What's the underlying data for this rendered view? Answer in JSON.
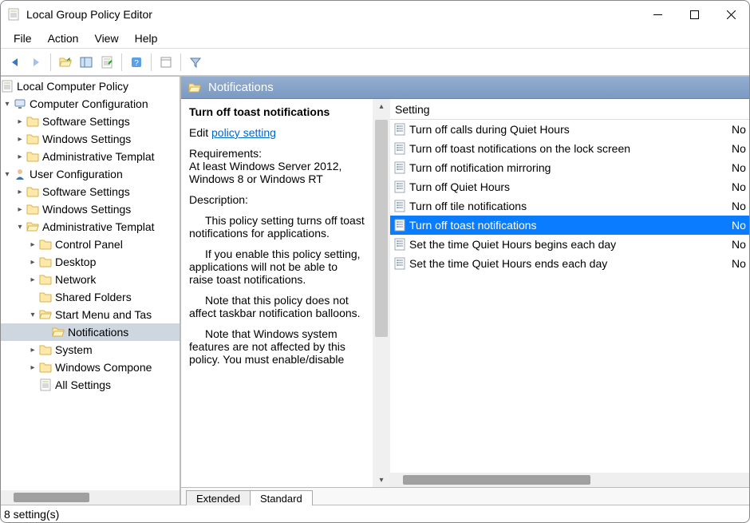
{
  "window": {
    "title": "Local Group Policy Editor"
  },
  "menu": {
    "items": [
      "File",
      "Action",
      "View",
      "Help"
    ]
  },
  "tree": {
    "root": "Local Computer Policy",
    "compConfig": "Computer Configuration",
    "cc_software": "Software Settings",
    "cc_windows": "Windows Settings",
    "cc_admin": "Administrative Templat",
    "userConfig": "User Configuration",
    "uc_software": "Software Settings",
    "uc_windows": "Windows Settings",
    "uc_admin": "Administrative Templat",
    "ctrl": "Control Panel",
    "desktop": "Desktop",
    "network": "Network",
    "shared": "Shared Folders",
    "start": "Start Menu and Tas",
    "notif": "Notifications",
    "system": "System",
    "wincomp": "Windows Compone",
    "allset": "All Settings"
  },
  "panel": {
    "heading": "Notifications",
    "selectedTitle": "Turn off toast notifications",
    "editPrefix": "Edit",
    "editLink": "policy setting",
    "reqLabel": "Requirements:",
    "reqText": "At least Windows Server 2012, Windows 8 or Windows RT",
    "descLabel": "Description:",
    "d1": "This policy setting turns off toast notifications for applications.",
    "d2": "If you enable this policy setting, applications will not be able to raise toast notifications.",
    "d3": "Note that this policy does not affect taskbar notification balloons.",
    "d4": "Note that Windows system features are not affected by this policy.  You must enable/disable"
  },
  "grid": {
    "colSetting": "Setting",
    "rows": [
      {
        "label": "Turn off calls during Quiet Hours",
        "state": "No"
      },
      {
        "label": "Turn off toast notifications on the lock screen",
        "state": "No"
      },
      {
        "label": "Turn off notification mirroring",
        "state": "No"
      },
      {
        "label": "Turn off Quiet Hours",
        "state": "No"
      },
      {
        "label": "Turn off tile notifications",
        "state": "No"
      },
      {
        "label": "Turn off toast notifications",
        "state": "No"
      },
      {
        "label": "Set the time Quiet Hours begins each day",
        "state": "No"
      },
      {
        "label": "Set the time Quiet Hours ends each day",
        "state": "No"
      }
    ]
  },
  "tabs": {
    "extended": "Extended",
    "standard": "Standard"
  },
  "status": {
    "text": "8 setting(s)"
  }
}
